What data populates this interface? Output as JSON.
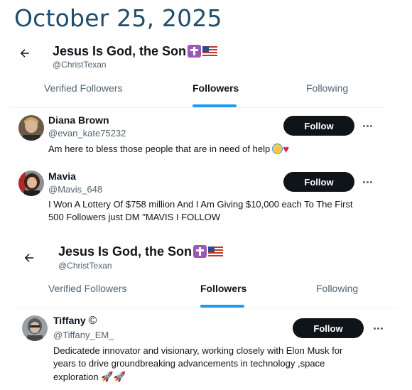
{
  "date_heading": "October 25, 2025",
  "screens": [
    {
      "profile": {
        "name": "Jesus Is God, the Son",
        "handle": "@ChristTexan"
      },
      "tabs": [
        {
          "label": "Verified Followers"
        },
        {
          "label": "Followers",
          "active": true
        },
        {
          "label": "Following"
        }
      ],
      "users": [
        {
          "name": "Diana Brown",
          "handle": "@evan_kate75232",
          "bio": "Am here to bless those people that are in need of help",
          "follow_label": "Follow"
        },
        {
          "name": "Mavia",
          "handle": "@Mavis_648",
          "bio_line1": "I Won A Lottery Of $758 million And I Am Giving $10,000 each To The First",
          "bio_line2": "500 Followers just DM \"MAVIS I FOLLOW",
          "follow_label": "Follow"
        }
      ]
    },
    {
      "profile": {
        "name": "Jesus Is God, the Son",
        "handle": "@ChristTexan"
      },
      "tabs": [
        {
          "label": "Verified Followers"
        },
        {
          "label": "Followers",
          "active": true
        },
        {
          "label": "Following"
        }
      ],
      "users": [
        {
          "name": "Tiffany",
          "name_symbol": "©",
          "handle": "@Tiffany_EM_",
          "bio_line1": "Dedicatede innovator and visionary, working closely with Elon Musk for",
          "bio_line2": "years to drive groundbreaking advancements in technology ,space",
          "bio_line3": "exploration",
          "follow_label": "Follow"
        }
      ]
    }
  ],
  "colors": {
    "heading": "#1f4e6b",
    "tab_underline": "#1d9bf0",
    "follow_button": "#0f1419",
    "secondary_text": "#536471"
  },
  "icons": [
    "back-arrow-icon",
    "more-options-icon",
    "latin-cross-emoji",
    "us-flag-emoji",
    "smiling-face-with-halo-emoji",
    "red-heart-emoji",
    "rocket-emoji"
  ]
}
